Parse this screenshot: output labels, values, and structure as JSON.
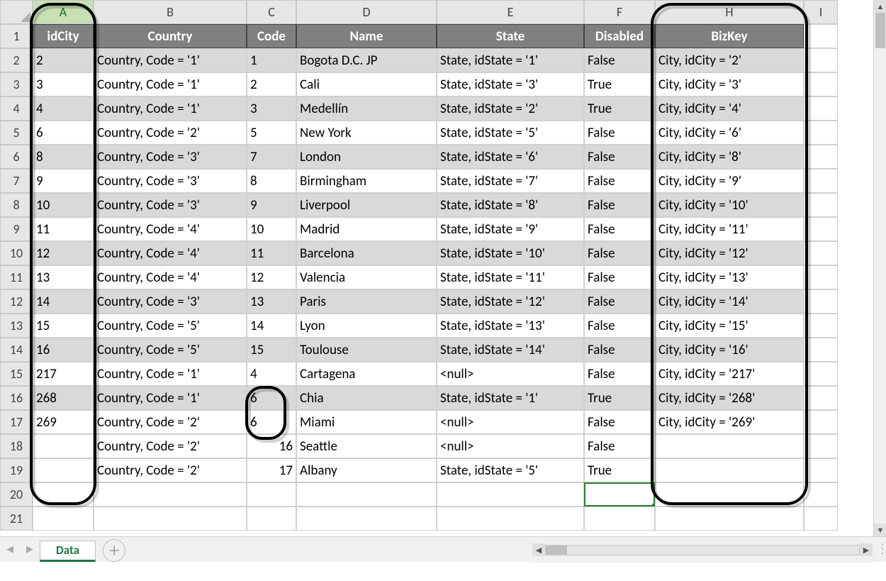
{
  "columns": [
    "A",
    "B",
    "C",
    "D",
    "E",
    "F",
    "H",
    "I"
  ],
  "rowNumbers": [
    1,
    2,
    3,
    4,
    5,
    6,
    7,
    8,
    9,
    10,
    11,
    12,
    13,
    14,
    15,
    16,
    17,
    18,
    19,
    20,
    21
  ],
  "selectedColumnIndex": 0,
  "selectedCell": {
    "row": 20,
    "col": "F"
  },
  "headers": {
    "A": "idCity",
    "B": "Country",
    "C": "Code",
    "D": "Name",
    "E": "State",
    "F": "Disabled",
    "H": "BizKey"
  },
  "rows": [
    {
      "shade": true,
      "A": "2",
      "B": "Country, Code = '1'",
      "C": "1",
      "D": "Bogota D.C. JP",
      "E": "State, idState = '1'",
      "F": "False",
      "H": "City, idCity = '2'"
    },
    {
      "shade": false,
      "A": "3",
      "B": "Country, Code = '1'",
      "C": "2",
      "D": "Cali",
      "E": "State, idState = '3'",
      "F": "True",
      "H": "City, idCity = '3'"
    },
    {
      "shade": true,
      "A": "4",
      "B": "Country, Code = '1'",
      "C": "3",
      "D": "Medellín",
      "E": "State, idState = '2'",
      "F": "True",
      "H": "City, idCity = '4'"
    },
    {
      "shade": false,
      "A": "6",
      "B": "Country, Code = '2'",
      "C": "5",
      "D": "New York",
      "E": "State, idState = '5'",
      "F": "False",
      "H": "City, idCity = '6'"
    },
    {
      "shade": true,
      "A": "8",
      "B": "Country, Code = '3'",
      "C": "7",
      "D": "London",
      "E": "State, idState = '6'",
      "F": "False",
      "H": "City, idCity = '8'"
    },
    {
      "shade": false,
      "A": "9",
      "B": "Country, Code = '3'",
      "C": "8",
      "D": "Birmingham",
      "E": "State, idState = '7'",
      "F": "False",
      "H": "City, idCity = '9'"
    },
    {
      "shade": true,
      "A": "10",
      "B": "Country, Code = '3'",
      "C": "9",
      "D": "Liverpool",
      "E": "State, idState = '8'",
      "F": "False",
      "H": "City, idCity = '10'"
    },
    {
      "shade": false,
      "A": "11",
      "B": "Country, Code = '4'",
      "C": "10",
      "D": "Madrid",
      "E": "State, idState = '9'",
      "F": "False",
      "H": "City, idCity = '11'"
    },
    {
      "shade": true,
      "A": "12",
      "B": "Country, Code = '4'",
      "C": "11",
      "D": "Barcelona",
      "E": "State, idState = '10'",
      "F": "False",
      "H": "City, idCity = '12'"
    },
    {
      "shade": false,
      "A": "13",
      "B": "Country, Code = '4'",
      "C": "12",
      "D": "Valencia",
      "E": "State, idState = '11'",
      "F": "False",
      "H": "City, idCity = '13'"
    },
    {
      "shade": true,
      "A": "14",
      "B": "Country, Code = '3'",
      "C": "13",
      "D": "Paris",
      "E": "State, idState = '12'",
      "F": "False",
      "H": "City, idCity = '14'"
    },
    {
      "shade": false,
      "A": "15",
      "B": "Country, Code = '5'",
      "C": "14",
      "D": "Lyon",
      "E": "State, idState = '13'",
      "F": "False",
      "H": "City, idCity = '15'"
    },
    {
      "shade": true,
      "A": "16",
      "B": "Country, Code = '5'",
      "C": "15",
      "D": "Toulouse",
      "E": "State, idState = '14'",
      "F": "False",
      "H": "City, idCity = '16'"
    },
    {
      "shade": false,
      "A": "217",
      "B": "Country, Code = '1'",
      "C": "4",
      "D": "Cartagena",
      "E": "<null>",
      "F": "False",
      "H": "City, idCity = '217'"
    },
    {
      "shade": true,
      "A": "268",
      "B": "Country, Code = '1'",
      "C": "6",
      "D": "Chia",
      "E": "State, idState = '1'",
      "F": "True",
      "H": "City, idCity = '268'"
    },
    {
      "shade": false,
      "A": "269",
      "B": "Country, Code = '2'",
      "C": "6",
      "D": "Miami",
      "E": "<null>",
      "F": "False",
      "H": "City, idCity = '269'"
    },
    {
      "shade": false,
      "A": "",
      "B": "Country, Code = '2'",
      "C": "16",
      "Cnum": true,
      "D": "Seattle",
      "E": "<null>",
      "F": "False",
      "H": ""
    },
    {
      "shade": false,
      "A": "",
      "B": "Country, Code = '2'",
      "C": "17",
      "Cnum": true,
      "D": "Albany",
      "E": "State, idState = '5'",
      "F": "True",
      "H": ""
    }
  ],
  "sheetTab": "Data"
}
